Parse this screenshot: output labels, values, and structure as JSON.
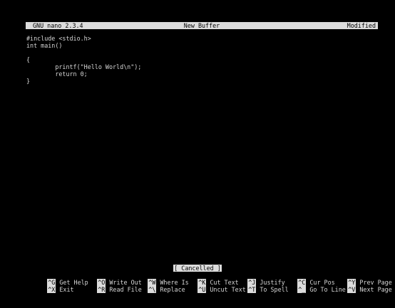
{
  "titlebar": {
    "app": "GNU nano 2.3.4",
    "buffer": "New Buffer",
    "state": "Modified"
  },
  "editor": {
    "lines": [
      "#include <stdio.h>",
      "int main()",
      "",
      "{",
      "        printf(\"Hello World\\n\");",
      "        return 0;",
      "}"
    ]
  },
  "status": {
    "message": "[ Cancelled ]"
  },
  "shortcuts": {
    "row1": [
      {
        "key": "^G",
        "label": "Get Help"
      },
      {
        "key": "^O",
        "label": "Write Out"
      },
      {
        "key": "^W",
        "label": "Where Is"
      },
      {
        "key": "^K",
        "label": "Cut Text"
      },
      {
        "key": "^J",
        "label": "Justify"
      },
      {
        "key": "^C",
        "label": "Cur Pos"
      },
      {
        "key": "^Y",
        "label": "Prev Page"
      }
    ],
    "row2": [
      {
        "key": "^X",
        "label": "Exit"
      },
      {
        "key": "^R",
        "label": "Read File"
      },
      {
        "key": "^\\",
        "label": "Replace"
      },
      {
        "key": "^U",
        "label": "Uncut Text"
      },
      {
        "key": "^T",
        "label": "To Spell"
      },
      {
        "key": "^_",
        "label": "Go To Line"
      },
      {
        "key": "^V",
        "label": "Next Page"
      }
    ]
  },
  "colors": {
    "background": "#000000",
    "text": "#d6d6d6",
    "inverse_bg": "#dcdcdc",
    "inverse_fg": "#000000"
  }
}
